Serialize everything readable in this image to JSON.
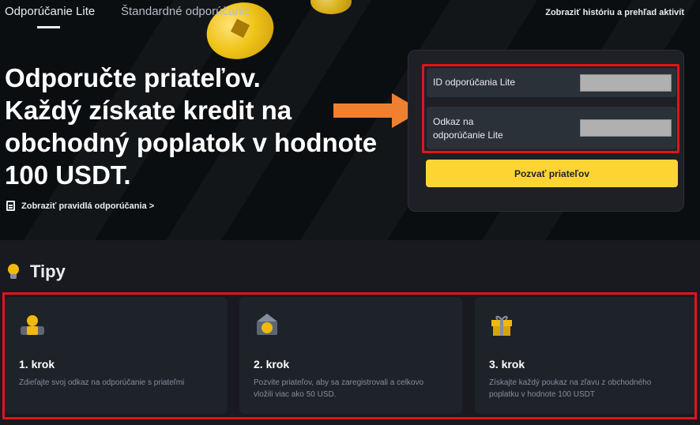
{
  "tabs": [
    {
      "label": "Odporúčanie Lite",
      "active": true
    },
    {
      "label": "Štandardné odporúčanie",
      "active": false
    }
  ],
  "header": {
    "history_link": "Zobraziť históriu a prehľad aktivít"
  },
  "hero": {
    "headline_lines": [
      "Odporučte priateľov.",
      "Každý získate kredit na",
      "obchodný poplatok v hodnote",
      "100 USDT."
    ],
    "rules_link": "Zobraziť pravidlá odporúčania >"
  },
  "referral_panel": {
    "id_label": "ID odporúčania Lite",
    "link_label_line1": "Odkaz na",
    "link_label_line2": "odporúčanie Lite",
    "invite_button": "Pozvať priateľov"
  },
  "tips": {
    "title": "Tipy",
    "steps": [
      {
        "title": "1. krok",
        "description": "Zdieľajte svoj odkaz na odporúčanie s priateľmi",
        "icon": "user-icon"
      },
      {
        "title": "2. krok",
        "description": "Pozvite priateľov, aby sa zaregistrovali a celkovo vložili viac ako 50 USD.",
        "icon": "coin-deposit-icon"
      },
      {
        "title": "3. krok",
        "description": "Získajte každý poukaz na zľavu z obchodného poplatku v hodnote 100 USDT",
        "icon": "gift-icon"
      }
    ]
  },
  "colors": {
    "accent": "#fcd535",
    "highlight": "#e0141c",
    "arrow": "#f08030"
  }
}
